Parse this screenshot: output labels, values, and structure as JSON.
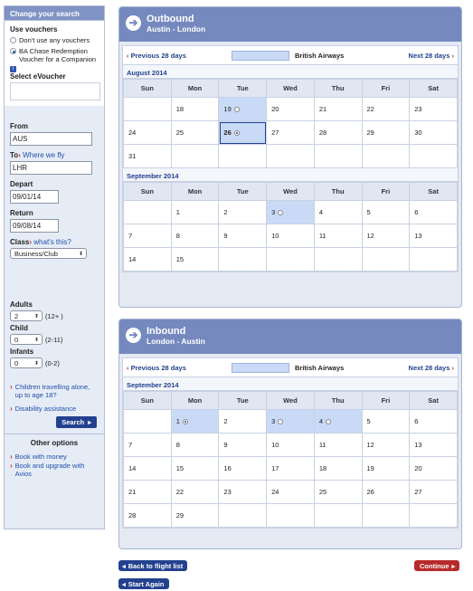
{
  "sidebar": {
    "heading": "Change your search",
    "use_vouchers_label": "Use vouchers",
    "voucher_options": [
      {
        "label": "Don't use any vouchers",
        "selected": false
      },
      {
        "label": "BA Chase Redemption Voucher for a Companion",
        "selected": true
      }
    ],
    "info_glyph": "i",
    "select_evoucher_label": "Select eVoucher",
    "from_label": "From",
    "from_value": "AUS",
    "to_label": "To",
    "to_link": "Where we fly",
    "to_value": "LHR",
    "depart_label": "Depart",
    "depart_value": "09/01/14",
    "return_label": "Return",
    "return_value": "09/08/14",
    "class_label": "Class",
    "class_link": "what's this?",
    "class_value": "Business/Club",
    "adults_label": "Adults",
    "adults_value": "2",
    "adults_range": "(12+ )",
    "child_label": "Child",
    "child_value": "0",
    "child_range": "(2-11)",
    "infants_label": "Infants",
    "infants_value": "0",
    "infants_range": "(0-2)",
    "children_alone_link": "Children travelling alone, up to age 18?",
    "disability_link": "Disability assistance",
    "search_button": "Search",
    "other_options_heading": "Other options",
    "other_links": [
      "Book with money",
      "Book and upgrade with Avios"
    ]
  },
  "outbound": {
    "title": "Outbound",
    "route": "Austin - London",
    "prev_label": "Previous 28 days",
    "next_label": "Next 28 days",
    "airline": "British Airways",
    "weekday_headers": [
      "Sun",
      "Mon",
      "Tue",
      "Wed",
      "Thu",
      "Fri",
      "Sat"
    ],
    "months": [
      {
        "label": "August 2014",
        "rows": [
          [
            "",
            "18",
            "19",
            "20",
            "21",
            "22",
            "23"
          ],
          [
            "24",
            "25",
            "26",
            "27",
            "28",
            "29",
            "30"
          ],
          [
            "31",
            "",
            "",
            "",
            "",
            "",
            ""
          ]
        ]
      },
      {
        "label": "September 2014",
        "rows": [
          [
            "",
            "1",
            "2",
            "3",
            "4",
            "5",
            "6"
          ],
          [
            "7",
            "8",
            "9",
            "10",
            "11",
            "12",
            "13"
          ],
          [
            "14",
            "15",
            "",
            "",
            "",
            "",
            ""
          ]
        ]
      }
    ]
  },
  "inbound": {
    "title": "Inbound",
    "route": "London - Austin",
    "prev_label": "Previous 28 days",
    "next_label": "Next 28 days",
    "airline": "British Airways",
    "weekday_headers": [
      "Sun",
      "Mon",
      "Tue",
      "Wed",
      "Thu",
      "Fri",
      "Sat"
    ],
    "months": [
      {
        "label": "September 2014",
        "rows": [
          [
            "",
            "1",
            "2",
            "3",
            "4",
            "5",
            "6"
          ],
          [
            "7",
            "8",
            "9",
            "10",
            "11",
            "12",
            "13"
          ],
          [
            "14",
            "15",
            "16",
            "17",
            "18",
            "19",
            "20"
          ],
          [
            "21",
            "22",
            "23",
            "24",
            "25",
            "26",
            "27"
          ],
          [
            "28",
            "29",
            "",
            "",
            "",
            "",
            ""
          ]
        ]
      }
    ]
  },
  "buttons": {
    "back_to_flight_list": "Back to flight list",
    "start_again": "Start Again",
    "continue": "Continue"
  },
  "colors": {
    "panel_header": "#7589bf",
    "available_date": "#c9daf6",
    "nav_blue": "#23418f",
    "continue_red": "#b72a2c"
  }
}
